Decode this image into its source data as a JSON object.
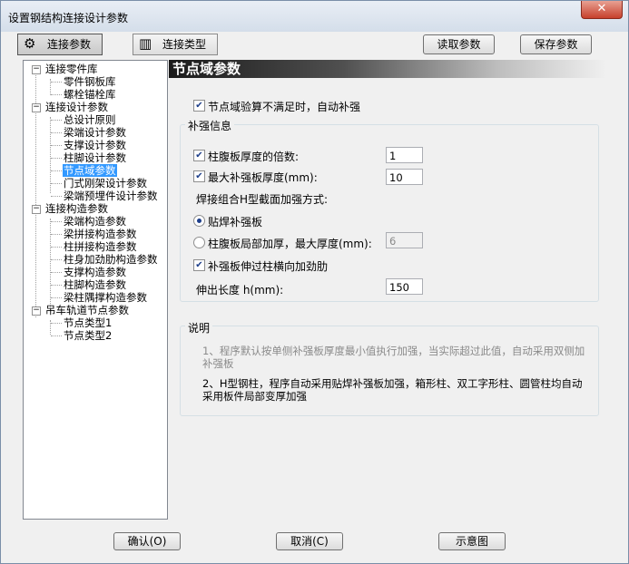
{
  "window": {
    "title": "设置钢结构连接设计参数",
    "close_glyph": "✕"
  },
  "toolbar": {
    "tab_connection_params": "连接参数",
    "tab_connection_types": "连接类型",
    "read_params": "读取参数",
    "save_params": "保存参数"
  },
  "tree": {
    "n1": "连接零件库",
    "n1a": "零件钢板库",
    "n1b": "螺栓锚栓库",
    "n2": "连接设计参数",
    "n2a": "总设计原则",
    "n2b": "梁端设计参数",
    "n2c": "支撑设计参数",
    "n2d": "柱脚设计参数",
    "n2e": "节点域参数",
    "n2f": "门式刚架设计参数",
    "n2g": "梁端预埋件设计参数",
    "n3": "连接构造参数",
    "n3a": "梁端构造参数",
    "n3b": "梁拼接构造参数",
    "n3c": "柱拼接构造参数",
    "n3d": "柱身加劲肋构造参数",
    "n3e": "支撑构造参数",
    "n3f": "柱脚构造参数",
    "n3g": "梁柱隅撑构造参数",
    "n4": "吊车轨道节点参数",
    "n4a": "节点类型1",
    "n4b": "节点类型2"
  },
  "panel": {
    "header": "节点域参数",
    "reinforce_when_fail": "节点域验算不满足时，自动补强",
    "group_title": "补强信息",
    "web_thickness_multiple_label": "柱腹板厚度的倍数:",
    "web_thickness_multiple_value": "1",
    "max_plate_thickness_label": "最大补强板厚度(mm):",
    "max_plate_thickness_value": "10",
    "method_label": "焊接组合H型截面加强方式:",
    "radio_weld_plate": "贴焊补强板",
    "radio_local_thicken": "柱腹板局部加厚，最大厚度(mm):",
    "local_thicken_value": "6",
    "extend_stiffener": "补强板伸过柱横向加劲肋",
    "extend_length_label": "伸出长度 h(mm):",
    "extend_length_value": "150",
    "notes_title": "说明",
    "note1": "1、程序默认按单侧补强板厚度最小值执行加强，当实际超过此值，自动采用双侧加补强板",
    "note2": "2、H型钢柱，程序自动采用贴焊补强板加强，箱形柱、双工字形柱、圆管柱均自动采用板件局部变厚加强"
  },
  "bottom": {
    "ok": "确认(O)",
    "cancel": "取消(C)",
    "diagram": "示意图"
  }
}
